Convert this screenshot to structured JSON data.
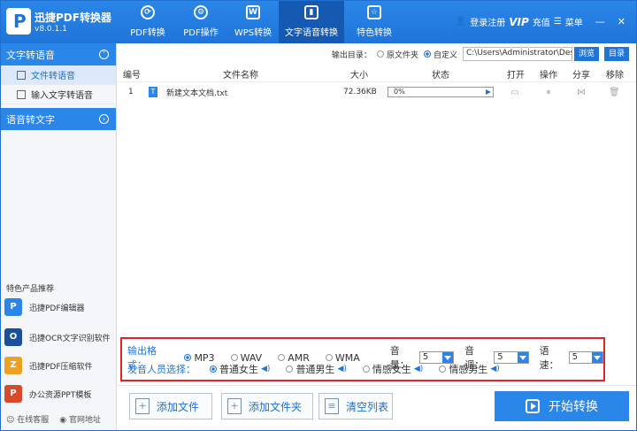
{
  "app": {
    "title": "迅捷PDF转换器",
    "version": "v8.0.1.1"
  },
  "nav": [
    {
      "label": "PDF转换"
    },
    {
      "label": "PDF操作"
    },
    {
      "label": "WPS转换"
    },
    {
      "label": "文字语音转换"
    },
    {
      "label": "特色转换"
    }
  ],
  "user": {
    "login": "登录注册",
    "vip": "VIP",
    "recharge": "充值",
    "menu": "菜单"
  },
  "sidebar": {
    "section1": "文字转语音",
    "items": [
      {
        "label": "文件转语音"
      },
      {
        "label": "输入文字转语音"
      }
    ],
    "section2": "语音转文字",
    "promo_title": "特色产品推荐",
    "promos": [
      {
        "label": "迅捷PDF编辑器"
      },
      {
        "label": "迅捷OCR文字识别软件"
      },
      {
        "label": "迅捷PDF压缩软件"
      },
      {
        "label": "办公资源PPT模板"
      }
    ],
    "footer": {
      "service": "在线客服",
      "website": "官网地址"
    }
  },
  "output": {
    "label": "输出目录：",
    "opt_original": "原文件夹",
    "opt_custom": "自定义",
    "path": "C:\\Users\\Administrator\\Desktop",
    "browse": "浏览",
    "dir": "目录"
  },
  "table": {
    "headers": {
      "num": "编号",
      "name": "文件名称",
      "size": "大小",
      "status": "状态",
      "open": "打开",
      "action": "操作",
      "share": "分享",
      "remove": "移除"
    },
    "rows": [
      {
        "num": "1",
        "name": "新建文本文档.txt",
        "size": "72.36KB",
        "progress": "0%"
      }
    ]
  },
  "settings": {
    "format_label": "输出格式：",
    "formats": [
      "MP3",
      "WAV",
      "AMR",
      "WMA"
    ],
    "selected_format": "MP3",
    "volume_label": "音量：",
    "volume": "5",
    "pitch_label": "音调：",
    "pitch": "5",
    "speed_label": "语速：",
    "speed": "5",
    "voice_label": "发音人员选择：",
    "voices": [
      "普通女生",
      "普通男生",
      "情感女生",
      "情感男生"
    ],
    "selected_voice": "普通女生"
  },
  "buttons": {
    "add_file": "添加文件",
    "add_folder": "添加文件夹",
    "clear": "清空列表",
    "start": "开始转换"
  },
  "colors": {
    "accent": "#2a86e8",
    "highlight_border": "#e0242a"
  }
}
